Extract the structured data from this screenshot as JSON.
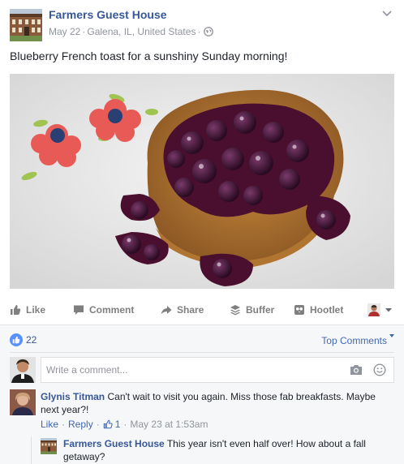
{
  "post": {
    "page_name": "Farmers Guest House",
    "date": "May 22",
    "location": "Galena, IL, United States",
    "caption": "Blueberry French toast for a sunshiny Sunday morning!"
  },
  "actions": {
    "like": "Like",
    "comment": "Comment",
    "share": "Share",
    "buffer": "Buffer",
    "hootlet": "Hootlet"
  },
  "reactions": {
    "count": "22",
    "sort_label": "Top Comments"
  },
  "composer": {
    "placeholder": "Write a comment..."
  },
  "comments": [
    {
      "author": "Glynis Titman",
      "text": "Can't wait to visit you again. Miss those fab breakfasts. Maybe next year?!",
      "like_label": "Like",
      "reply_label": "Reply",
      "likes": "1",
      "time": "May 23 at 1:53am",
      "replies": [
        {
          "author": "Farmers Guest House",
          "text": "This year isn't even half over! How about a fall getaway?"
        }
      ]
    }
  ],
  "colors": {
    "link": "#365899",
    "accent": "#4267b2",
    "like_badge": "#5890ff",
    "muted": "#90949c",
    "feedback_bg": "#f6f7f9"
  },
  "icons": [
    "globe-icon",
    "chevron-down-icon",
    "like-icon",
    "comment-icon",
    "share-icon",
    "buffer-icon",
    "hootlet-icon",
    "camera-icon",
    "smiley-icon"
  ]
}
